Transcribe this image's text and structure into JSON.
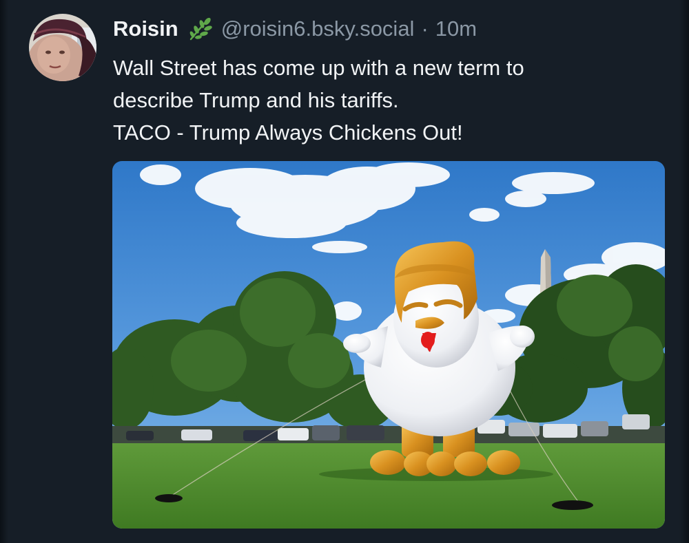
{
  "post": {
    "author": {
      "display_name": "Roisin",
      "badge_icon": "leaf-sprig-icon",
      "handle": "@roisin6.bsky.social",
      "separator": "·",
      "time": "10m"
    },
    "text_lines": [
      "Wall Street has come up with a new term to",
      "describe Trump and his tariffs.",
      "TACO - Trump Always Chickens Out!"
    ]
  },
  "colors": {
    "background": "#161e27",
    "text": "#f1f3f5",
    "muted": "#8b98a5",
    "leaf_green": "#5fa84a"
  }
}
